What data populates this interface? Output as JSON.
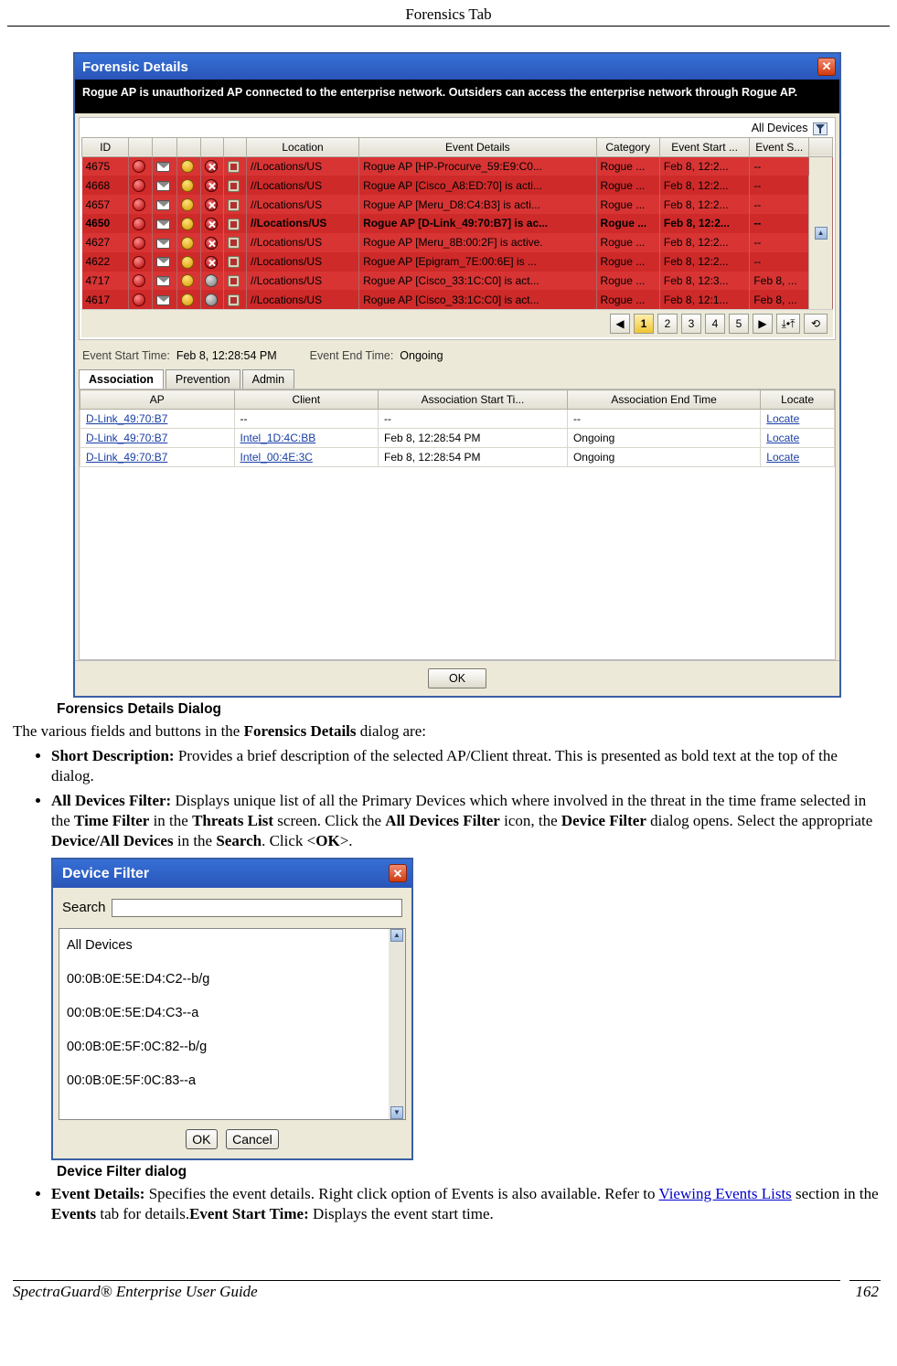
{
  "page_header": "Forensics Tab",
  "caption_forensic": "Forensics Details Dialog",
  "caption_device_filter": "Device Filter dialog",
  "intro_text_prefix": "The various fields and buttons in the ",
  "intro_text_bold": "Forensics Details",
  "intro_text_suffix": " dialog are:",
  "bullets": {
    "b1_label": "Short Description:",
    "b1_text": " Provides a brief description of the selected AP/Client threat. This is presented as bold text at the top of the dialog.",
    "b2_label": "All Devices Filter:",
    "b2_t1": " Displays unique list of all the Primary Devices which where involved in the threat in the time frame selected in the ",
    "b2_b1": "Time Filter",
    "b2_t2": " in the ",
    "b2_b2": "Threats List",
    "b2_t3": " screen. Click the ",
    "b2_b3": "All Devices Filter",
    "b2_t4": " icon, the ",
    "b2_b4": "Device Filter",
    "b2_t5": " dialog opens. Select the appropriate ",
    "b2_b5": "Device/All Devices",
    "b2_t6": " in the ",
    "b2_b6": "Search",
    "b2_t7": ". Click <",
    "b2_b7": "OK",
    "b2_t8": ">.",
    "b3_label": "Event Details:",
    "b3_t1": " Specifies the event details. Right click option of Events is also available. Refer to ",
    "b3_link": "Viewing Events Lists",
    "b3_t2": " section in the ",
    "b3_b1": "Events",
    "b3_t3": " tab for details.",
    "b3_b2": "Event Start Time:",
    "b3_t4": " Displays the event start time."
  },
  "footer": {
    "left": "SpectraGuard®  Enterprise User Guide",
    "right": "162"
  },
  "forensic_dialog": {
    "title": "Forensic Details",
    "short_desc": "Rogue AP is unauthorized AP connected to the enterprise network. Outsiders can access the enterprise network through Rogue AP.",
    "filter_label": "All Devices",
    "cols": {
      "id": "ID",
      "loc": "Location",
      "det": "Event Details",
      "cat": "Category",
      "start": "Event Start ...",
      "stop": "Event S..."
    },
    "rows": [
      {
        "id": "4675",
        "loc": "//Locations/US",
        "det": "Rogue AP [HP-Procurve_59:E9:C0...",
        "cat": "Rogue ...",
        "start": "Feb 8, 12:2...",
        "stop": "--",
        "bold": false
      },
      {
        "id": "4668",
        "loc": "//Locations/US",
        "det": "Rogue AP [Cisco_A8:ED:70] is acti...",
        "cat": "Rogue ...",
        "start": "Feb 8, 12:2...",
        "stop": "--",
        "bold": false
      },
      {
        "id": "4657",
        "loc": "//Locations/US",
        "det": "Rogue AP [Meru_D8:C4:B3] is acti...",
        "cat": "Rogue ...",
        "start": "Feb 8, 12:2...",
        "stop": "--",
        "bold": false
      },
      {
        "id": "4650",
        "loc": "//Locations/US",
        "det": "Rogue AP [D-Link_49:70:B7] is ac...",
        "cat": "Rogue ...",
        "start": "Feb 8, 12:2...",
        "stop": "--",
        "bold": true
      },
      {
        "id": "4627",
        "loc": "//Locations/US",
        "det": "Rogue AP [Meru_8B:00:2F] is active.",
        "cat": "Rogue ...",
        "start": "Feb 8, 12:2...",
        "stop": "--",
        "bold": false
      },
      {
        "id": "4622",
        "loc": "//Locations/US",
        "det": "Rogue AP [Epigram_7E:00:6E] is ...",
        "cat": "Rogue ...",
        "start": "Feb 8, 12:2...",
        "stop": "--",
        "bold": false
      },
      {
        "id": "4717",
        "loc": "//Locations/US",
        "det": "Rogue AP [Cisco_33:1C:C0] is act...",
        "cat": "Rogue ...",
        "start": "Feb 8, 12:3...",
        "stop": "Feb 8, ...",
        "bold": false
      },
      {
        "id": "4617",
        "loc": "//Locations/US",
        "det": "Rogue AP [Cisco_33:1C:C0] is act...",
        "cat": "Rogue ...",
        "start": "Feb 8, 12:1...",
        "stop": "Feb 8, ...",
        "bold": false
      }
    ],
    "pager": {
      "prev": "◀",
      "next": "▶",
      "pages": [
        "1",
        "2",
        "3",
        "4",
        "5"
      ],
      "active": "1"
    },
    "time": {
      "start_lbl": "Event Start Time:",
      "start_val": "Feb 8, 12:28:54 PM",
      "end_lbl": "Event End Time:",
      "end_val": "Ongoing"
    },
    "tabs": [
      "Association",
      "Prevention",
      "Admin"
    ],
    "assoc_cols": {
      "ap": "AP",
      "client": "Client",
      "astart": "Association Start Ti...",
      "aend": "Association End Time",
      "locate": "Locate"
    },
    "assoc_rows": [
      {
        "ap": "D-Link_49:70:B7",
        "client": "--",
        "astart": "--",
        "aend": "--",
        "locate": "Locate"
      },
      {
        "ap": "D-Link_49:70:B7",
        "client": "Intel_1D:4C:BB",
        "astart": "Feb 8, 12:28:54 PM",
        "aend": "Ongoing",
        "locate": "Locate"
      },
      {
        "ap": "D-Link_49:70:B7",
        "client": "Intel_00:4E:3C",
        "astart": "Feb 8, 12:28:54 PM",
        "aend": "Ongoing",
        "locate": "Locate"
      }
    ],
    "ok": "OK"
  },
  "device_filter": {
    "title": "Device Filter",
    "search_label": "Search",
    "items": [
      "All Devices",
      "00:0B:0E:5E:D4:C2--b/g",
      "00:0B:0E:5E:D4:C3--a",
      "00:0B:0E:5F:0C:82--b/g",
      "00:0B:0E:5F:0C:83--a"
    ],
    "ok": "OK",
    "cancel": "Cancel"
  }
}
